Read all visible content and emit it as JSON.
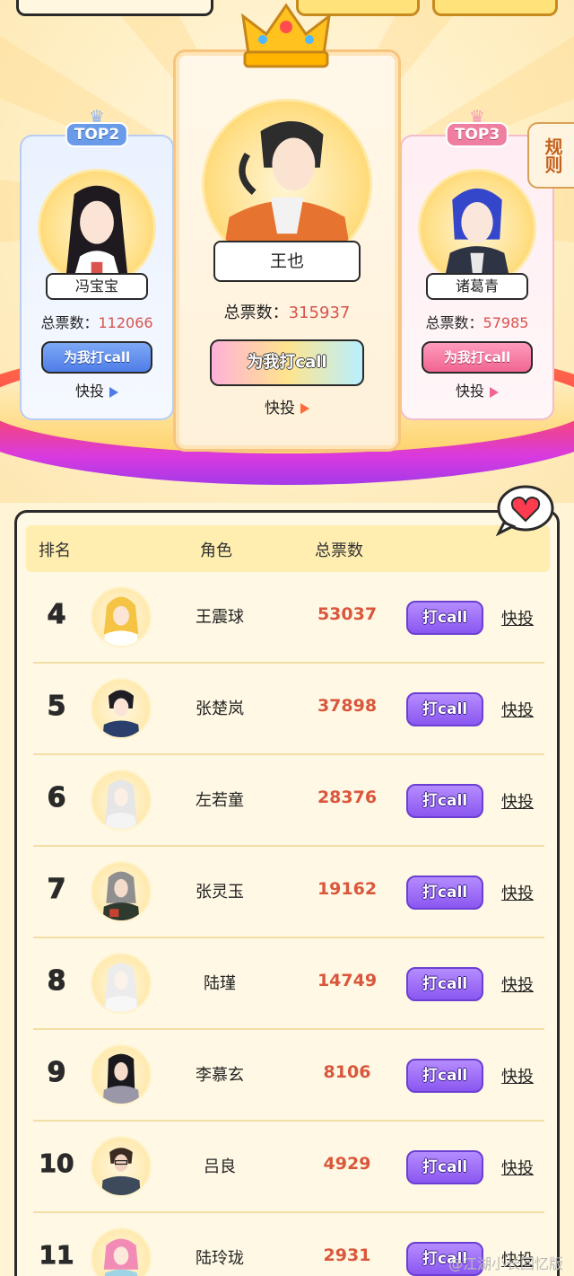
{
  "podium": {
    "first": {
      "name": "王也",
      "votes_label": "总票数：",
      "votes": "315937",
      "call_label": "为我打call",
      "quick_label": "快投"
    },
    "second": {
      "badge": "TOP2",
      "name": "冯宝宝",
      "votes_label": "总票数：",
      "votes": "112066",
      "call_label": "为我打call",
      "quick_label": "快投"
    },
    "third": {
      "badge": "TOP3",
      "name": "诸葛青",
      "votes_label": "总票数：",
      "votes": "57985",
      "call_label": "为我打call",
      "quick_label": "快投"
    }
  },
  "rules_label": "规则",
  "table": {
    "headers": {
      "rank": "排名",
      "role": "角色",
      "votes": "总票数"
    },
    "call_label": "打call",
    "quick_label": "快投",
    "rows": [
      {
        "rank": "4",
        "name": "王震球",
        "votes": "53037"
      },
      {
        "rank": "5",
        "name": "张楚岚",
        "votes": "37898"
      },
      {
        "rank": "6",
        "name": "左若童",
        "votes": "28376"
      },
      {
        "rank": "7",
        "name": "张灵玉",
        "votes": "19162"
      },
      {
        "rank": "8",
        "name": "陆瑾",
        "votes": "14749"
      },
      {
        "rank": "9",
        "name": "李慕玄",
        "votes": "8106"
      },
      {
        "rank": "10",
        "name": "吕良",
        "votes": "4929"
      },
      {
        "rank": "11",
        "name": "陆玲珑",
        "votes": "2931"
      }
    ]
  },
  "watermark": "@江湖小长回忆版",
  "colors": {
    "votes_red": "#d9573c",
    "call_purple": "#8a57f0",
    "top2_blue": "#4f7de8",
    "top3_pink": "#f06591"
  }
}
